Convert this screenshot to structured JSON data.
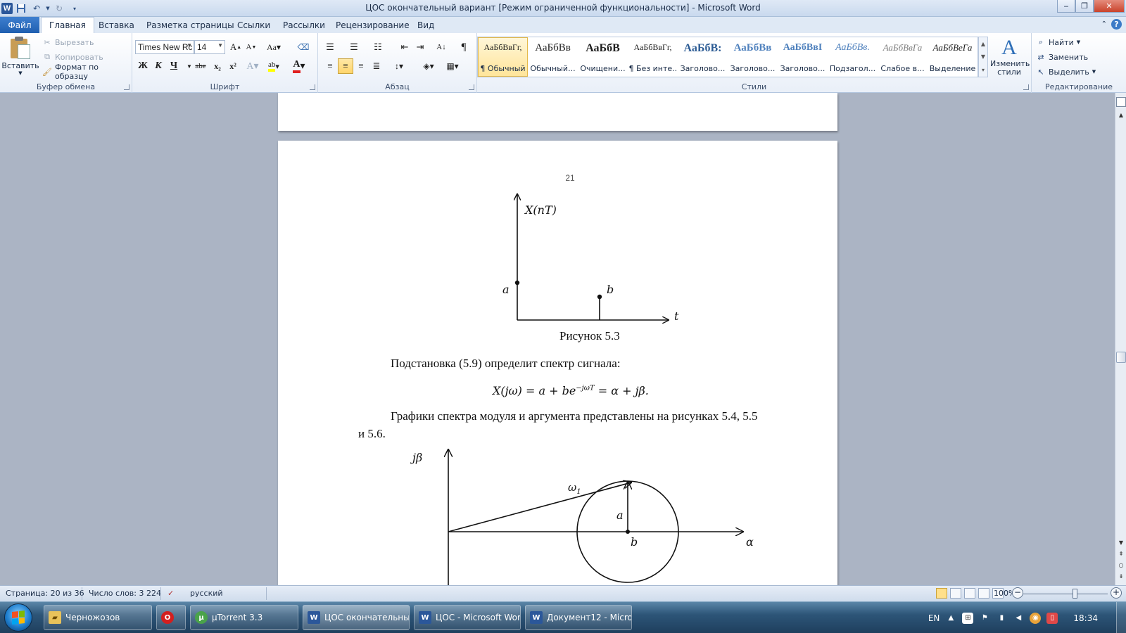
{
  "window": {
    "title": "ЦОС окончательный вариант [Режим ограниченной функциональности]  -  Microsoft Word",
    "app_icon": "W"
  },
  "tabs": {
    "file": "Файл",
    "items": [
      "Главная",
      "Вставка",
      "Разметка страницы",
      "Ссылки",
      "Рассылки",
      "Рецензирование",
      "Вид"
    ]
  },
  "ribbon": {
    "clipboard": {
      "paste": "Вставить",
      "cut": "Вырезать",
      "copy": "Копировать",
      "format_painter": "Формат по образцу",
      "label": "Буфер обмена"
    },
    "font": {
      "name": "Times New Rc",
      "size": "14",
      "bold": "Ж",
      "italic": "К",
      "underline": "Ч",
      "strike": "abe",
      "subscript": "x₂",
      "superscript": "x²",
      "label": "Шрифт"
    },
    "paragraph": {
      "label": "Абзац"
    },
    "styles": {
      "label": "Стили",
      "change_styles": "Изменить стили",
      "items": [
        {
          "sample": "АаБбВвГг,",
          "name": "¶ Обычный",
          "selected": true
        },
        {
          "sample": "АаБбВв",
          "name": "Обычный...",
          "selected": false
        },
        {
          "sample": "АаБбВ",
          "name": "Очищени...",
          "selected": false
        },
        {
          "sample": "АаБбВвГг,",
          "name": "¶ Без инте...",
          "selected": false
        },
        {
          "sample": "АаБбВ:",
          "name": "Заголово...",
          "selected": false
        },
        {
          "sample": "АаБбВв",
          "name": "Заголово...",
          "selected": false
        },
        {
          "sample": "АаБбВвІ",
          "name": "Заголово...",
          "selected": false
        },
        {
          "sample": "АаБбВв.",
          "name": "Подзагол...",
          "selected": false
        },
        {
          "sample": "АаБбВвГа",
          "name": "Слабое в...",
          "selected": false
        },
        {
          "sample": "АаБбВеГа",
          "name": "Выделение",
          "selected": false
        }
      ]
    },
    "editing": {
      "label": "Редактирование",
      "find": "Найти",
      "replace": "Заменить",
      "select": "Выделить"
    }
  },
  "document": {
    "page_number": "21",
    "figure1": {
      "y_axis_label": "X(nT)",
      "x_axis_label": "t",
      "point_a": "a",
      "point_b": "b",
      "caption": "Рисунок 5.3"
    },
    "para1": "Подстановка (5.9) определит спектр сигнала:",
    "formula": {
      "lhs": "X(jω) = a + be",
      "exponent": "−jωT",
      "rhs": " = α + jβ."
    },
    "para2_line1": "Графики спектра модуля и аргумента представлены на рисунках 5.4, 5.5",
    "para2_line2": "и 5.6.",
    "figure2": {
      "y_axis_label": "jβ",
      "x_axis_label": "α",
      "omega_label": "ω",
      "omega_sub": "1",
      "radius_label": "a",
      "center_label": "b"
    }
  },
  "status": {
    "page": "Страница: 20 из 36",
    "words": "Число слов: 3 224",
    "language": "русский",
    "zoom": "100%",
    "zoom_level_percent": 100
  },
  "taskbar": {
    "items": [
      {
        "label": "Черножозов",
        "icon": "folder-icon"
      },
      {
        "label": "",
        "icon": "opera-icon"
      },
      {
        "label": "µTorrent 3.3",
        "icon": "utorrent-icon"
      },
      {
        "label": "ЦОС окончательны...",
        "icon": "word-icon"
      },
      {
        "label": "ЦОС - Microsoft Word",
        "icon": "word-icon"
      },
      {
        "label": "Документ12 - Micro...",
        "icon": "word-icon"
      }
    ],
    "language": "EN",
    "clock": "18:34"
  },
  "colors": {
    "accent": "#2b579a",
    "file_tab": "#1f5fb0",
    "page": "#ffffff",
    "canvas": "#abb4c4"
  }
}
